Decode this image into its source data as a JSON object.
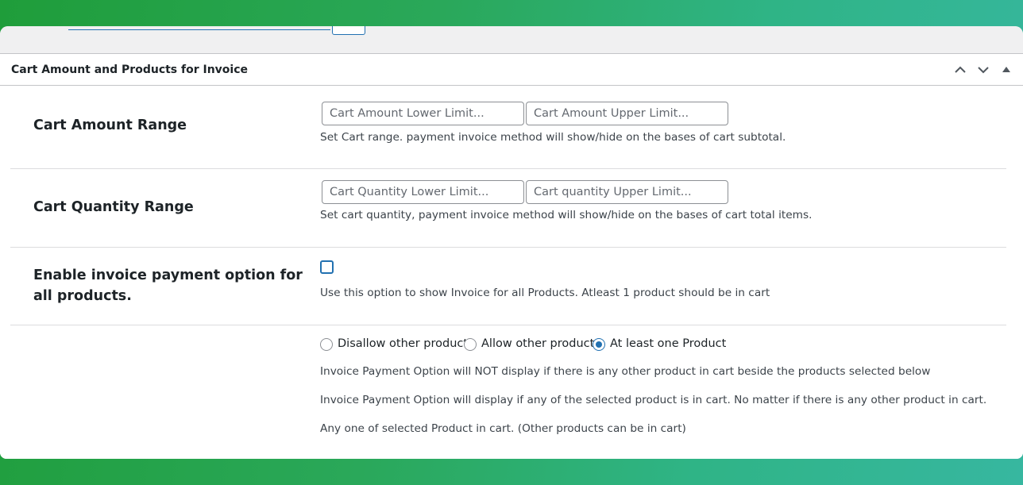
{
  "panel": {
    "title": "Cart Amount and Products for Invoice",
    "controls": [
      "chevron-up-icon",
      "chevron-down-icon",
      "triangle-up-icon"
    ]
  },
  "cart_amount": {
    "label": "Cart Amount Range",
    "lower_placeholder": "Cart Amount Lower Limit...",
    "upper_placeholder": "Cart Amount Upper Limit...",
    "description": "Set Cart range. payment invoice method will show/hide on the bases of cart subtotal."
  },
  "cart_quantity": {
    "label": "Cart Quantity Range",
    "lower_placeholder": "Cart Quantity Lower Limit...",
    "upper_placeholder": "Cart quantity Upper Limit...",
    "description": "Set cart quantity, payment invoice method will show/hide on the bases of cart total items."
  },
  "enable_all": {
    "label": "Enable invoice payment option for all products.",
    "checked": false,
    "description": "Use this option to show Invoice for all Products. Atleast 1 product should be in cart"
  },
  "product_mode": {
    "options": [
      {
        "label": "Disallow other products",
        "selected": false
      },
      {
        "label": "Allow other products",
        "selected": false
      },
      {
        "label": "At least one Product",
        "selected": true
      }
    ],
    "notes": [
      "Invoice Payment Option will NOT display if there is any other product in cart beside the products selected below",
      "Invoice Payment Option will display if any of the selected product is in cart. No matter if there is any other product in cart.",
      "Any one of selected Product in cart. (Other products can be in cart)"
    ]
  },
  "colors": {
    "accent": "#2271b1",
    "border": "#c3c4c7",
    "text": "#1d2327",
    "background_gradient": [
      "#1f9d3a",
      "#37b7a0"
    ]
  }
}
